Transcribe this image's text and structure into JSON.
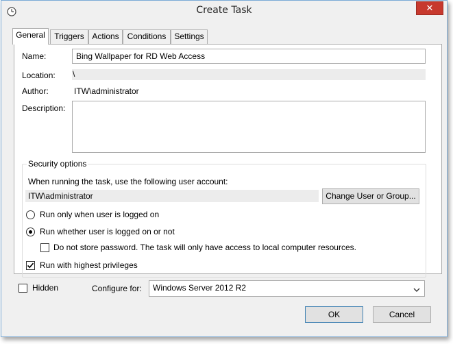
{
  "window": {
    "title": "Create Task",
    "close_glyph": "✕"
  },
  "tabs": [
    {
      "label": "General",
      "active": true
    },
    {
      "label": "Triggers"
    },
    {
      "label": "Actions"
    },
    {
      "label": "Conditions"
    },
    {
      "label": "Settings"
    }
  ],
  "general": {
    "name_label": "Name:",
    "name_value": "Bing Wallpaper for RD Web Access",
    "location_label": "Location:",
    "location_value": "\\",
    "author_label": "Author:",
    "author_value": "ITW\\administrator",
    "description_label": "Description:",
    "description_value": ""
  },
  "security": {
    "legend": "Security options",
    "prompt": "When running the task, use the following user account:",
    "account": "ITW\\administrator",
    "change_button": "Change User or Group...",
    "radio_logged_on": {
      "label": "Run only when user is logged on",
      "checked": false
    },
    "radio_whether": {
      "label": "Run whether user is logged on or not",
      "checked": true
    },
    "no_store_password": {
      "label": "Do not store password.  The task will only have access to local computer resources.",
      "checked": false
    },
    "highest_privileges": {
      "label": "Run with highest privileges",
      "checked": true
    }
  },
  "footer": {
    "hidden_label": "Hidden",
    "hidden_checked": false,
    "configure_label": "Configure for:",
    "configure_value": "Windows Server 2012 R2",
    "ok_button": "OK",
    "cancel_button": "Cancel"
  },
  "icons": {
    "window_icon": "clock-icon",
    "dropdown": "chevron-down-icon",
    "check": "checkmark-icon"
  },
  "colors": {
    "window_border": "#7aaad6",
    "close_button": "#c7392e",
    "dialog_bg": "#f0f0f0",
    "default_button_border": "#3c7fb1"
  }
}
